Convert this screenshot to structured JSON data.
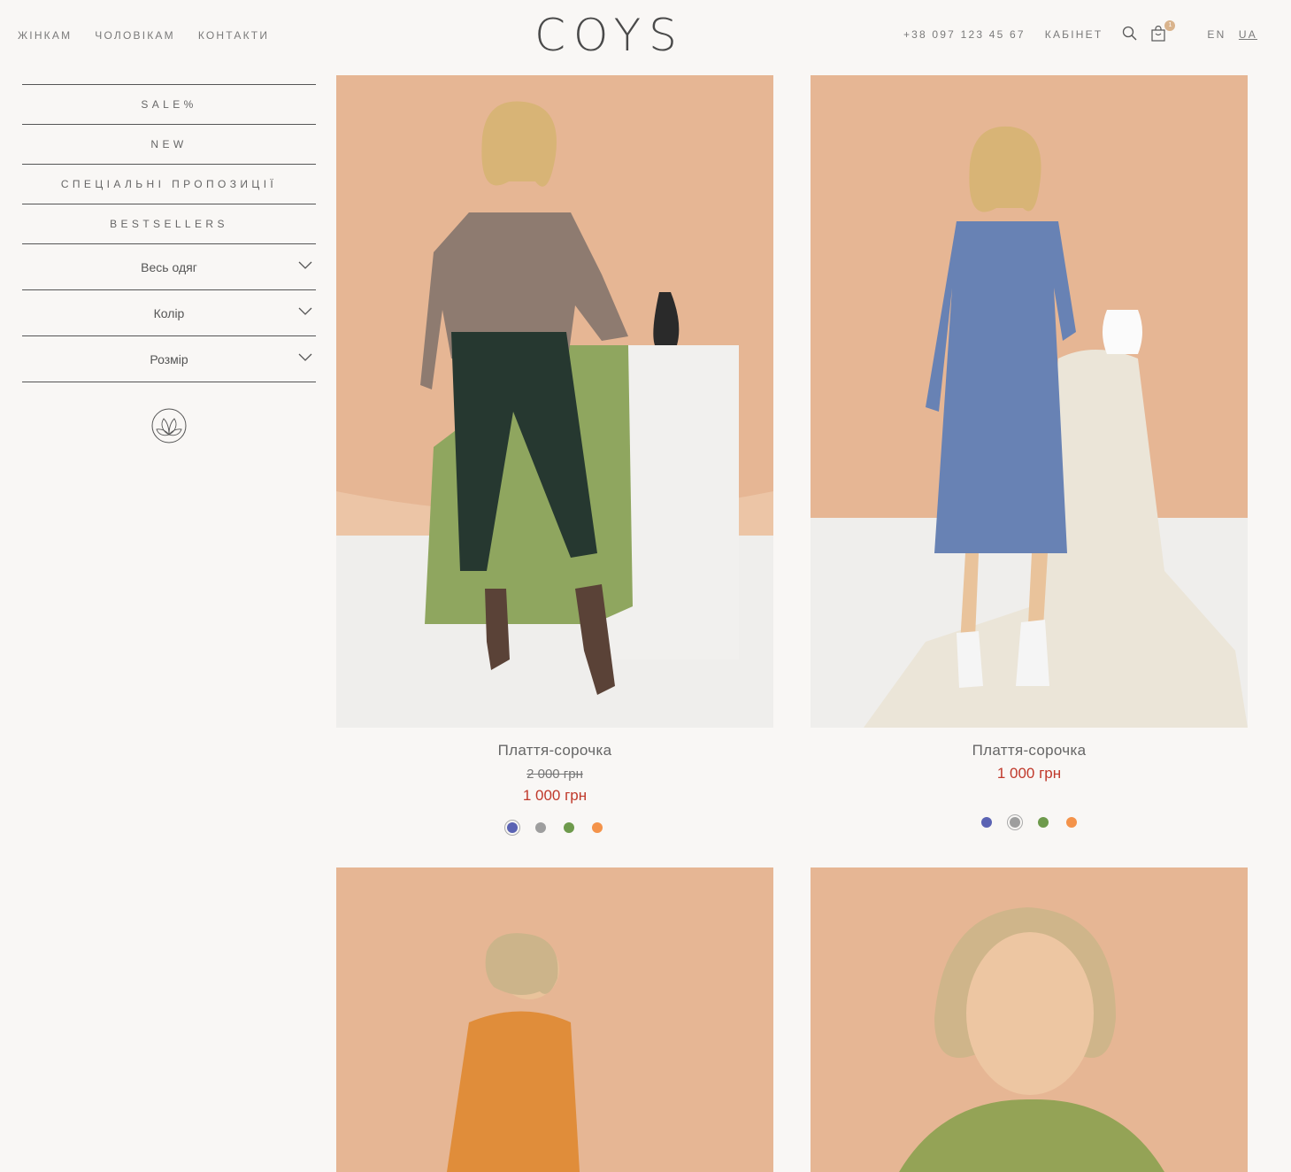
{
  "header": {
    "nav_left": [
      "Жінкам",
      "Чоловікам",
      "Контакти"
    ],
    "logo": "COYS",
    "phone": "+38 097 123 45 67",
    "cabinet": "Кабінет",
    "cart_count": "1",
    "lang_en": "EN",
    "lang_ua": "UA"
  },
  "sidebar": {
    "menu": [
      "SALE%",
      "NEW",
      "Спеціальні пропозиції",
      "BESTSELLERS"
    ],
    "filters": [
      "Весь одяг",
      "Колір",
      "Розмір"
    ]
  },
  "products": [
    {
      "name": "Плаття-сорочка",
      "old_price": "2 000 грн",
      "price": "1 000 грн",
      "swatches": [
        "#5b63b3",
        "#9e9e9e",
        "#6e9a4c",
        "#f4934a"
      ]
    },
    {
      "name": "Плаття-сорочка",
      "old_price": "",
      "price": "1 000 грн",
      "swatches": [
        "#5b63b3",
        "#9e9e9e",
        "#6e9a4c",
        "#f4934a"
      ]
    },
    {
      "name": "",
      "price": ""
    },
    {
      "name": "",
      "price": ""
    }
  ],
  "colors": {
    "photo_bg": "#e6b694",
    "sale_red": "#c0392b",
    "page_bg": "#f9f7f5"
  }
}
